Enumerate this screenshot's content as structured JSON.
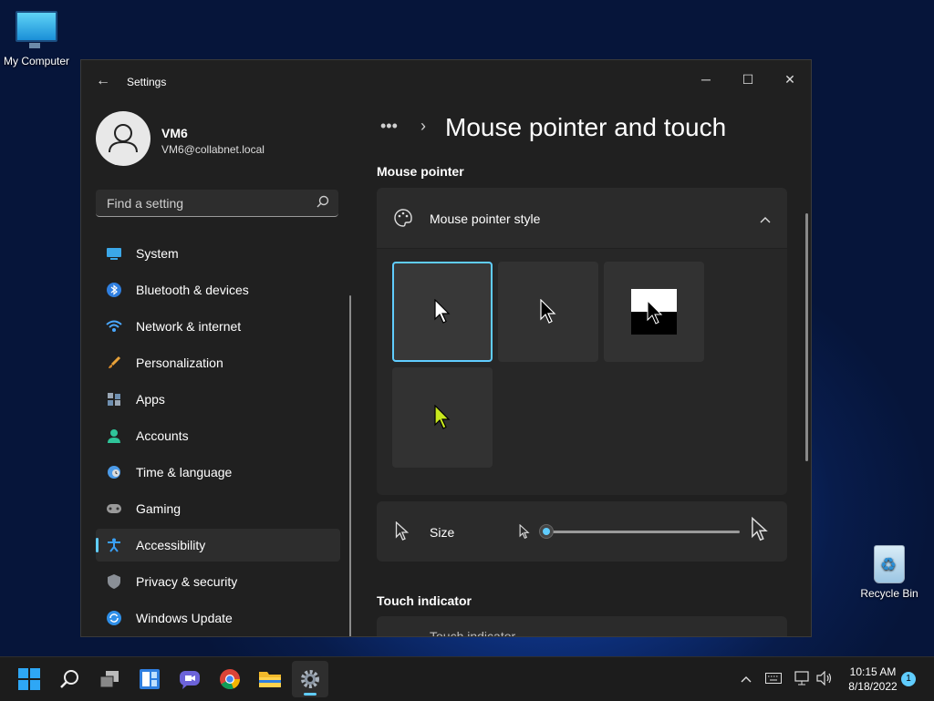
{
  "desktop": {
    "icons": [
      {
        "label": "My Computer"
      },
      {
        "label": "Recycle Bin"
      }
    ]
  },
  "window": {
    "title": "Settings",
    "controls": {
      "minimize": "─",
      "maximize": "☐",
      "close": "✕"
    }
  },
  "user": {
    "name": "VM6",
    "email": "VM6@collabnet.local"
  },
  "search": {
    "placeholder": "Find a setting"
  },
  "nav": {
    "items": [
      {
        "label": "System",
        "icon": "system-icon"
      },
      {
        "label": "Bluetooth & devices",
        "icon": "bluetooth-icon"
      },
      {
        "label": "Network & internet",
        "icon": "wifi-icon"
      },
      {
        "label": "Personalization",
        "icon": "brush-icon"
      },
      {
        "label": "Apps",
        "icon": "apps-icon"
      },
      {
        "label": "Accounts",
        "icon": "accounts-icon"
      },
      {
        "label": "Time & language",
        "icon": "globe-clock-icon"
      },
      {
        "label": "Gaming",
        "icon": "controller-icon"
      },
      {
        "label": "Accessibility",
        "icon": "accessibility-icon",
        "active": true
      },
      {
        "label": "Privacy & security",
        "icon": "shield-icon"
      },
      {
        "label": "Windows Update",
        "icon": "update-icon"
      }
    ]
  },
  "page": {
    "breadcrumb_ellipsis": "•••",
    "breadcrumb_sep": "›",
    "title": "Mouse pointer and touch"
  },
  "mouse_pointer": {
    "section_label": "Mouse pointer",
    "style_label": "Mouse pointer style",
    "styles": [
      {
        "name": "white",
        "selected": true
      },
      {
        "name": "black",
        "selected": false
      },
      {
        "name": "inverted",
        "selected": false
      },
      {
        "name": "custom",
        "selected": false
      }
    ],
    "size_label": "Size",
    "size_value": 0.0
  },
  "touch": {
    "section_label": "Touch indicator",
    "row_label": "Touch indicator"
  },
  "taskbar": {
    "apps": [
      "start-icon",
      "search-icon",
      "task-view-icon",
      "widgets-icon",
      "chat-icon",
      "chrome-icon",
      "file-explorer-icon",
      "settings-icon"
    ],
    "time": "10:15 AM",
    "date": "8/18/2022",
    "notification_count": "1"
  },
  "colors": {
    "accent": "#60cdff",
    "window_bg": "#202020",
    "card_bg": "#2b2b2b",
    "custom_pointer": "#c8e81e"
  }
}
